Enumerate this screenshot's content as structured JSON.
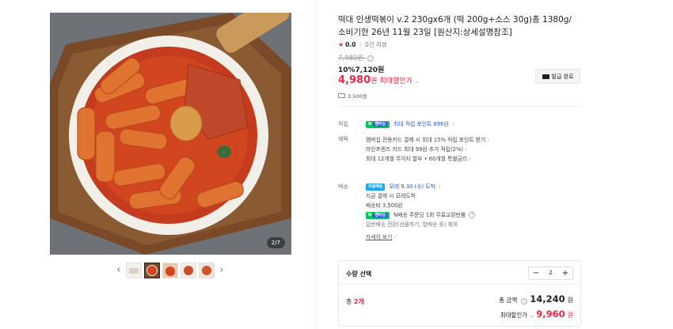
{
  "gallery": {
    "counter": "2/7",
    "prev_arrow": "‹",
    "next_arrow": "›",
    "thumb_count": 5,
    "active_thumb": 2
  },
  "product": {
    "title": "떡대 인생떡볶이 v.2 230gx6개 (떡 200g+소스 30g)총 1380g/소비기한 26년 11월 23일 [원산지:상세설명참조]",
    "rating": "0.0",
    "review_count": "0건 리뷰",
    "original_price": "7,980원",
    "discount_line": "10%7,120원",
    "max_price_num": "4,980",
    "max_price_unit": "원",
    "max_price_label": "최대할인가",
    "coupon_label": "발급 완료",
    "shipping_fee": "3,500원"
  },
  "benefits": {
    "points_label": "적립",
    "npay_badge": "N",
    "npay_sub": "멤버십",
    "points_text": "최대 적립 포인트 896원",
    "benefit_label": "혜택",
    "benefit_lines": [
      "멤버십 전용카드 결제 시 최대 15% 적립 포인트 받기",
      "라인프렌즈 카드 최대 99원 추가 적립(2%)",
      "최대 12개월 무이자 할부 • 60개월 특별금리"
    ]
  },
  "delivery": {
    "label": "배송",
    "badge": "오늘배송",
    "arrival": "모레 9.30 (수) 도착",
    "pay_note": "지금 결제 시 모레도착",
    "fee": "배송비 3,500원",
    "npay_exchange": "N배송 주문당 1회 무료교환반품",
    "excluded": "일반배송 전환(선물하기, 합배송 등) 제외",
    "more_link": "자세히 보기"
  },
  "order": {
    "qty_title": "수량 선택",
    "minus": "−",
    "qty_value": "2",
    "plus": "+",
    "total_qty_prefix": "총 ",
    "total_qty": "2개",
    "total_amount_label": "총 금액",
    "total_amount": "14,240",
    "total_amount_unit": "원",
    "total_max_label": "최대할인가",
    "total_max": "9,960",
    "total_max_unit": "원"
  },
  "colors": {
    "accent_red": "#f0284a",
    "npay_green": "#03c75a",
    "link_blue": "#2c5bd9"
  }
}
